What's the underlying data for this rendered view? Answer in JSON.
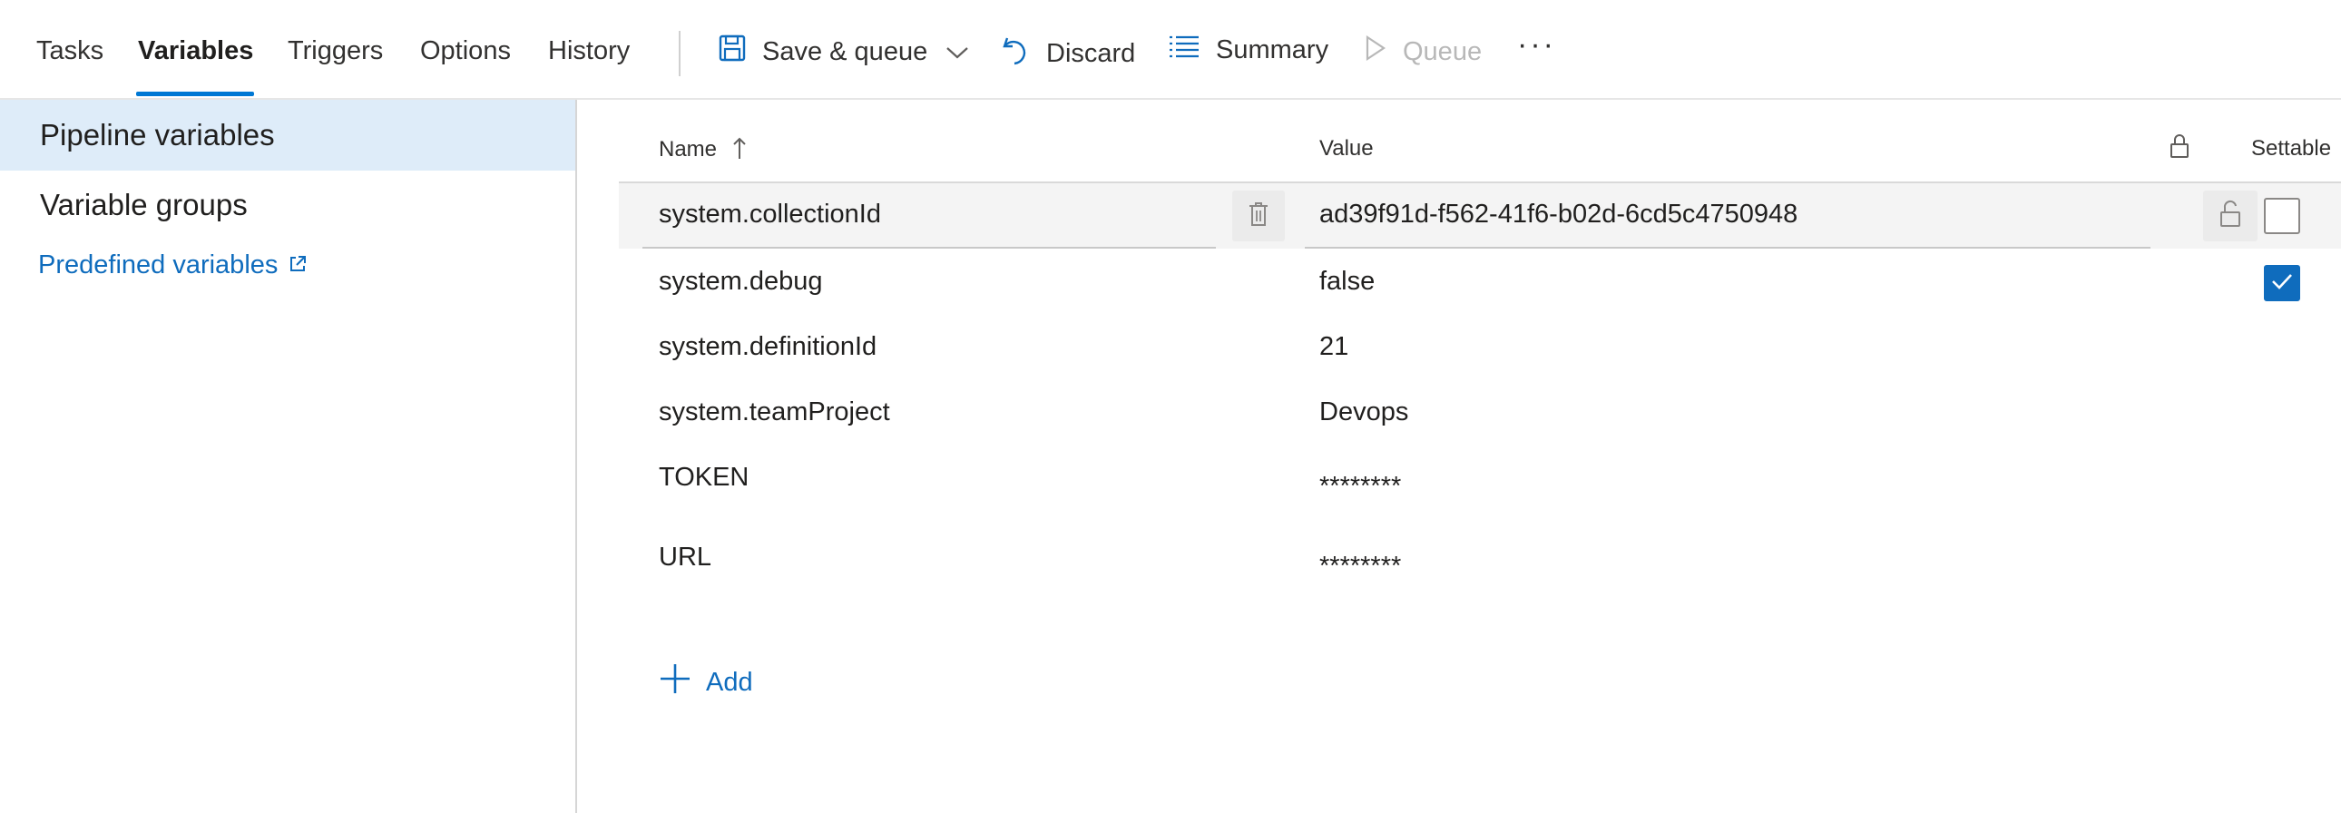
{
  "tabs": {
    "tasks": "Tasks",
    "variables": "Variables",
    "triggers": "Triggers",
    "options": "Options",
    "history": "History"
  },
  "toolbar": {
    "save_queue": "Save & queue",
    "discard": "Discard",
    "summary": "Summary",
    "queue": "Queue",
    "more": "···"
  },
  "sidebar": {
    "items": [
      "Pipeline variables",
      "Variable groups"
    ],
    "predefined_link": "Predefined variables"
  },
  "grid": {
    "headers": {
      "name": "Name",
      "value": "Value",
      "settable": "Settable"
    },
    "sort": "ascending",
    "rows": [
      {
        "name": "system.collectionId",
        "value": "ad39f91d-f562-41f6-b02d-6cd5c4750948",
        "settable": false
      },
      {
        "name": "system.debug",
        "value": "false",
        "settable": true
      },
      {
        "name": "system.definitionId",
        "value": "21"
      },
      {
        "name": "system.teamProject",
        "value": "Devops"
      },
      {
        "name": "TOKEN",
        "value": "********"
      },
      {
        "name": "URL",
        "value": "********"
      }
    ],
    "add_label": "Add"
  },
  "colors": {
    "accent": "#0078d4",
    "link": "#0f6cbd",
    "selected_nav": "#deecf9",
    "disabled": "#b8b8b8"
  }
}
